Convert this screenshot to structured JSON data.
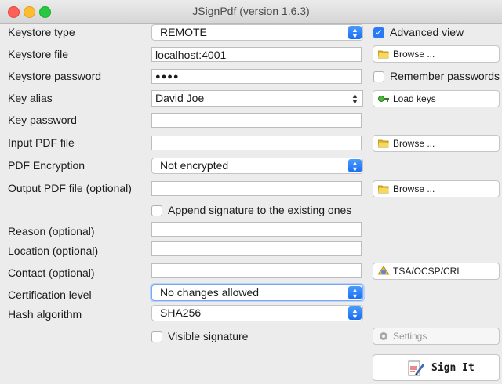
{
  "window": {
    "title": "JSignPdf (version 1.6.3)"
  },
  "labels": {
    "keystore_type": "Keystore type",
    "keystore_file": "Keystore file",
    "keystore_password": "Keystore password",
    "key_alias": "Key alias",
    "key_password": "Key password",
    "input_pdf": "Input PDF file",
    "pdf_encryption": "PDF Encryption",
    "output_pdf": "Output PDF file (optional)",
    "reason": "Reason (optional)",
    "location": "Location (optional)",
    "contact": "Contact (optional)",
    "cert_level": "Certification level",
    "hash_algorithm": "Hash algorithm"
  },
  "values": {
    "keystore_type": "REMOTE",
    "keystore_file": "localhost:4001",
    "keystore_password": "●●●●",
    "key_alias": "David Joe",
    "key_password": "",
    "input_pdf": "",
    "pdf_encryption": "Not encrypted",
    "output_pdf": "",
    "reason": "",
    "location": "",
    "contact": "",
    "cert_level": "No changes allowed",
    "hash_algorithm": "SHA256"
  },
  "checkboxes": {
    "advanced_view": {
      "label": "Advanced view",
      "checked": true
    },
    "remember_passwords": {
      "label": "Remember passwords",
      "checked": false
    },
    "append_signature": {
      "label": "Append signature to the existing ones",
      "checked": false
    },
    "visible_signature": {
      "label": "Visible signature",
      "checked": false
    }
  },
  "buttons": {
    "browse_keystore": "Browse ...",
    "load_keys": "Load keys",
    "browse_input": "Browse ...",
    "browse_output": "Browse ...",
    "tsa": "TSA/OCSP/CRL",
    "settings": "Settings",
    "sign_it": "Sign It"
  },
  "icons": {
    "folder": "folder-icon",
    "load_keys": "key-icon",
    "tsa": "tsa-icon",
    "settings": "gear-icon",
    "sign": "pen-document-icon"
  },
  "colors": {
    "accent": "#2a7af5"
  }
}
